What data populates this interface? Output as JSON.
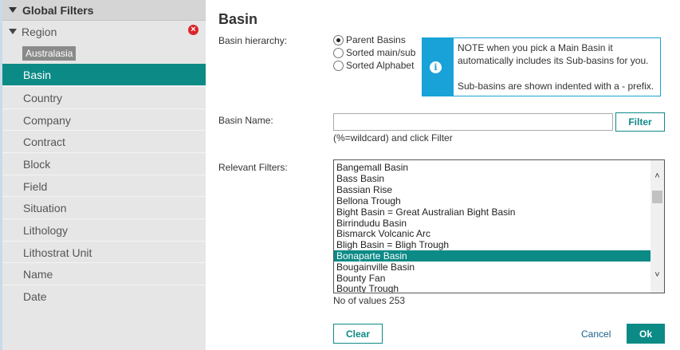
{
  "sidebar": {
    "header_label": "Global Filters",
    "region_label": "Region",
    "region_tag": "Australasia",
    "items": [
      {
        "label": "Basin"
      },
      {
        "label": "Country"
      },
      {
        "label": "Company"
      },
      {
        "label": "Contract"
      },
      {
        "label": "Block"
      },
      {
        "label": "Field"
      },
      {
        "label": "Situation"
      },
      {
        "label": "Lithology"
      },
      {
        "label": "Lithostrat Unit"
      },
      {
        "label": "Name"
      },
      {
        "label": "Date"
      }
    ],
    "active_item": "Basin",
    "colors": {
      "active_bg": "#0c8a86",
      "remove_icon": "#d9262c"
    }
  },
  "main": {
    "title": "Basin",
    "hierarchy": {
      "label": "Basin hierarchy:",
      "options": [
        {
          "label": "Parent Basins",
          "checked": true
        },
        {
          "label": "Sorted main/sub",
          "checked": false
        },
        {
          "label": "Sorted Alphabet",
          "checked": false
        }
      ]
    },
    "note": {
      "line1": "NOTE when you pick a Main Basin it automatically includes its Sub-basins for you.",
      "line2": "Sub-basins are shown indented with a - prefix.",
      "icon": "info-icon",
      "color": "#18a2d8"
    },
    "basin_name": {
      "label": "Basin Name:",
      "value": "",
      "filter_label": "Filter",
      "hint": "(%=wildcard) and click Filter"
    },
    "relevant": {
      "label": "Relevant Filters:",
      "items": [
        "Bangemall Basin",
        "Bass Basin",
        "Bassian Rise",
        "Bellona Trough",
        "Bight Basin = Great Australian Bight Basin",
        "Birrindudu Basin",
        "Bismarck Volcanic Arc",
        "Bligh Basin = Bligh Trough",
        "Bonaparte Basin",
        "Bougainville Basin",
        "Bounty Fan",
        "Bounty Trough"
      ],
      "selected": "Bonaparte Basin",
      "count_text": "No of values 253"
    },
    "actions": {
      "clear_label": "Clear",
      "cancel_label": "Cancel",
      "ok_label": "Ok"
    }
  }
}
